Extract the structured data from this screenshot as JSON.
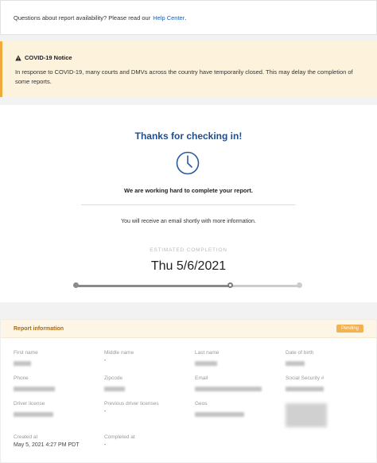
{
  "help": {
    "text": "Questions about report availability? Please read our",
    "link": "Help Center",
    "after": "."
  },
  "notice": {
    "icon": "warning-icon",
    "title": "COVID-19 Notice",
    "body": "In response to COVID-19, many courts and DMVs across the country have temporarily closed. This may delay the completion of some reports."
  },
  "status": {
    "title": "Thanks for checking in!",
    "icon": "clock-icon",
    "working": "We are working hard to complete your report.",
    "email_note": "You will receive an email shortly with more information.",
    "estimated_label": "ESTIMATED COMPLETION",
    "estimated_date": "Thu 5/6/2021",
    "progress_fraction": 0.69
  },
  "report": {
    "title": "Report information",
    "badge": "Pending",
    "badge_color": "#f2b24f",
    "fields": [
      {
        "label": "First name",
        "value": ""
      },
      {
        "label": "Middle name",
        "value": "-"
      },
      {
        "label": "Last name",
        "value": ""
      },
      {
        "label": "Date of birth",
        "value": ""
      },
      {
        "label": "Phone",
        "value": ""
      },
      {
        "label": "Zipcode",
        "value": ""
      },
      {
        "label": "Email",
        "value": ""
      },
      {
        "label": "Social Security #",
        "value": ""
      },
      {
        "label": "Driver license",
        "value": ""
      },
      {
        "label": "Previous driver licenses",
        "value": "-"
      },
      {
        "label": "Geos",
        "value": ""
      },
      {
        "label": "",
        "value": ""
      },
      {
        "label": "Created at",
        "value": "May 5, 2021 4:27 PM PDT"
      },
      {
        "label": "Completed at",
        "value": "-"
      }
    ]
  }
}
